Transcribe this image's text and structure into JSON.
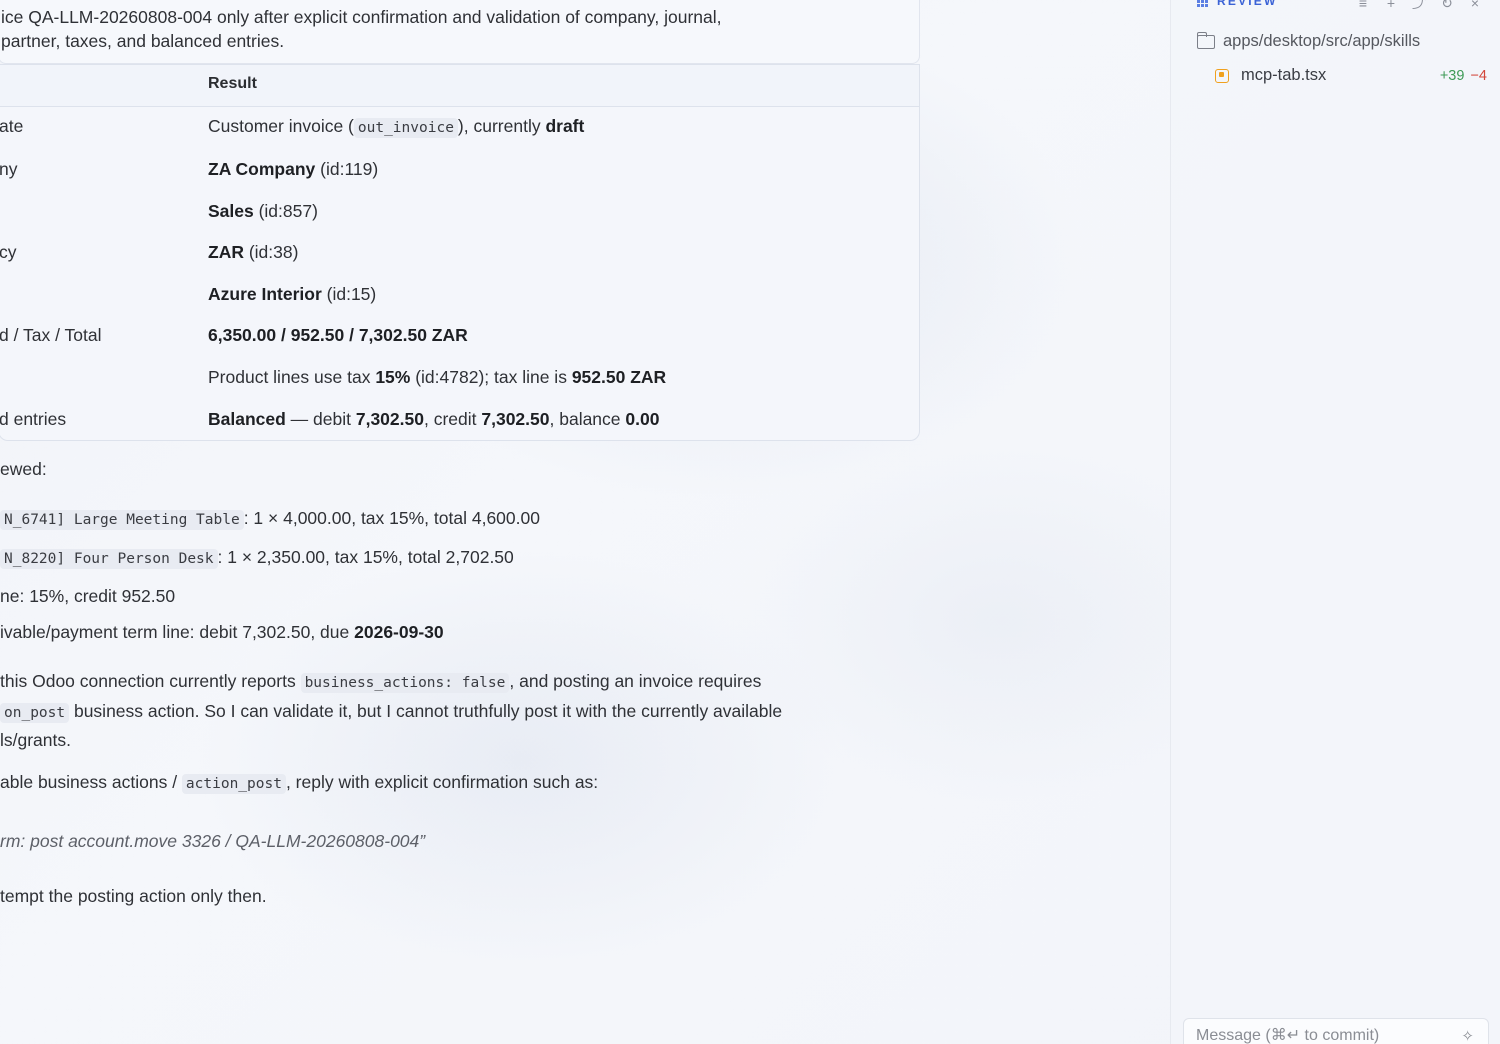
{
  "intro": {
    "line1": "ice QA-LLM-20260808-004 only after explicit confirmation and validation of company, journal,",
    "line2": " partner, taxes, and balanced entries."
  },
  "table": {
    "header_result": "Result",
    "rows": [
      {
        "label": "ate",
        "segments": [
          {
            "t": "Customer invoice (",
            "s": "plain"
          },
          {
            "t": "out_invoice",
            "s": "code"
          },
          {
            "t": "), currently ",
            "s": "plain"
          },
          {
            "t": "draft",
            "s": "bold"
          }
        ]
      },
      {
        "label": "ny",
        "segments": [
          {
            "t": "ZA Company",
            "s": "bold"
          },
          {
            "t": " (id:119)",
            "s": "plain"
          }
        ]
      },
      {
        "label": "",
        "segments": [
          {
            "t": "Sales",
            "s": "bold"
          },
          {
            "t": " (id:857)",
            "s": "plain"
          }
        ]
      },
      {
        "label": "cy",
        "segments": [
          {
            "t": "ZAR",
            "s": "bold"
          },
          {
            "t": " (id:38)",
            "s": "plain"
          }
        ]
      },
      {
        "label": "",
        "segments": [
          {
            "t": "Azure Interior",
            "s": "bold"
          },
          {
            "t": " (id:15)",
            "s": "plain"
          }
        ]
      },
      {
        "label": "d / Tax / Total",
        "segments": [
          {
            "t": "6,350.00 / 952.50 / 7,302.50 ZAR",
            "s": "bold"
          }
        ]
      },
      {
        "label": "",
        "segments": [
          {
            "t": "Product lines use tax ",
            "s": "plain"
          },
          {
            "t": "15%",
            "s": "bold"
          },
          {
            "t": " (id:4782); tax line is ",
            "s": "plain"
          },
          {
            "t": "952.50 ZAR",
            "s": "bold"
          }
        ]
      },
      {
        "label": "d entries",
        "segments": [
          {
            "t": "Balanced",
            "s": "bold"
          },
          {
            "t": " — debit ",
            "s": "plain"
          },
          {
            "t": "7,302.50",
            "s": "bold"
          },
          {
            "t": ", credit ",
            "s": "plain"
          },
          {
            "t": "7,302.50",
            "s": "bold"
          },
          {
            "t": ", balance ",
            "s": "plain"
          },
          {
            "t": "0.00",
            "s": "bold"
          }
        ]
      }
    ]
  },
  "body_lines": [
    [
      {
        "t": "ewed:",
        "s": "plain"
      }
    ],
    [
      {
        "t": "N_6741] Large Meeting Table",
        "s": "code"
      },
      {
        "t": ": 1 × 4,000.00, tax 15%, total 4,600.00",
        "s": "plain"
      }
    ],
    [
      {
        "t": "N_8220] Four Person Desk",
        "s": "code"
      },
      {
        "t": ": 1 × 2,350.00, tax 15%, total 2,702.50",
        "s": "plain"
      }
    ],
    [
      {
        "t": "ne: 15%, credit 952.50",
        "s": "plain"
      }
    ],
    [
      {
        "t": "ivable/payment term line: debit 7,302.50, due ",
        "s": "plain"
      },
      {
        "t": "2026-09-30",
        "s": "bold"
      }
    ],
    [
      {
        "t": "this Odoo connection currently reports ",
        "s": "plain"
      },
      {
        "t": "business_actions: false",
        "s": "code"
      },
      {
        "t": ", and posting an invoice requires",
        "s": "plain"
      }
    ],
    [
      {
        "t": "on_post",
        "s": "code"
      },
      {
        "t": " business action. So I can validate it, but I cannot truthfully post it with the currently available",
        "s": "plain"
      }
    ],
    [
      {
        "t": "ls/grants.",
        "s": "plain"
      }
    ],
    [
      {
        "t": "able business actions / ",
        "s": "plain"
      },
      {
        "t": "action_post",
        "s": "code"
      },
      {
        "t": ", reply with explicit confirmation such as:",
        "s": "plain"
      }
    ],
    [
      {
        "t": "rm: post account.move 3326 / QA-LLM-20260808-004”",
        "s": "quote"
      }
    ],
    [
      {
        "t": "tempt the posting action only then.",
        "s": "plain"
      }
    ]
  ],
  "review_panel": {
    "title": "REVIEW",
    "toolbar_icons": [
      "list-icon",
      "plus-icon",
      "branch-icon",
      "refresh-icon",
      "close-icon"
    ],
    "folder_path": "apps/desktop/src/app/skills",
    "files": [
      {
        "name": "mcp-tab.tsx",
        "additions": "+39",
        "deletions": "−4"
      }
    ],
    "message_placeholder": "Message (⌘↵ to commit)"
  },
  "colors": {
    "accent": "#3b63d6",
    "additions": "#3e9a56",
    "deletions": "#d2463a",
    "modified_badge": "#f0a11e"
  }
}
